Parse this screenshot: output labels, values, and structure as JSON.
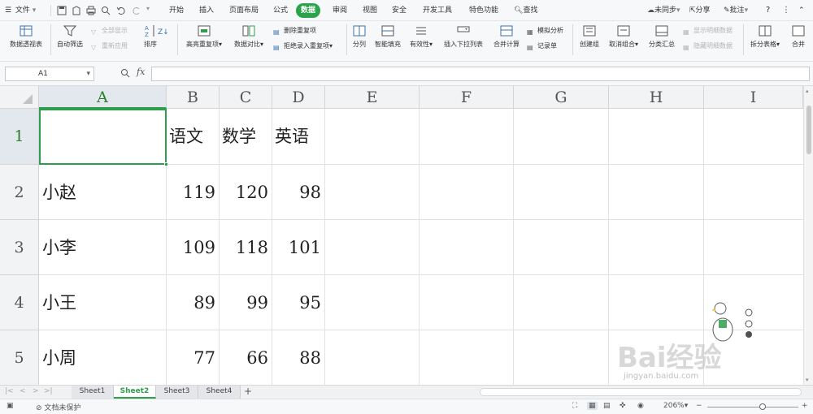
{
  "menu": {
    "file": "文件",
    "tabs": [
      "开始",
      "插入",
      "页面布局",
      "公式",
      "数据",
      "审阅",
      "视图",
      "安全",
      "开发工具",
      "特色功能"
    ],
    "active_tab": "数据",
    "search": "查找",
    "sync": "未同步",
    "share": "分享",
    "comment": "批注"
  },
  "ribbon": {
    "pivot": "数据透视表",
    "autofilter": "自动筛选",
    "show_all": "全部显示",
    "reapply": "重新应用",
    "sort": "排序",
    "highlight_dup": "高亮重复项",
    "compare": "数据对比",
    "delete_dup": "删除重复项",
    "reject_dup": "拒绝录入重复项",
    "split": "分列",
    "smart_fill": "智能填充",
    "validity": "有效性",
    "insert_dropdown": "插入下拉列表",
    "consolidate": "合并计算",
    "whatif": "模拟分析",
    "record": "记录单",
    "group": "创建组",
    "ungroup": "取消组合",
    "subtotal": "分类汇总",
    "show_detail": "显示明细数据",
    "hide_detail": "隐藏明细数据",
    "split_table": "拆分表格",
    "merge": "合并"
  },
  "formula_bar": {
    "cell_ref": "A1",
    "fx": "fx",
    "content": ""
  },
  "columns": [
    "A",
    "B",
    "C",
    "D",
    "E",
    "F",
    "G",
    "H",
    "I"
  ],
  "rows": [
    "1",
    "2",
    "3",
    "4",
    "5"
  ],
  "cells": [
    [
      "",
      "语文",
      "数学",
      "英语"
    ],
    [
      "小赵",
      "119",
      "120",
      "98"
    ],
    [
      "小李",
      "109",
      "118",
      "101"
    ],
    [
      "小王",
      "89",
      "99",
      "95"
    ],
    [
      "小周",
      "77",
      "66",
      "88"
    ]
  ],
  "sheets": [
    "Sheet1",
    "Sheet2",
    "Sheet3",
    "Sheet4"
  ],
  "active_sheet": "Sheet2",
  "add_sheet": "+",
  "status": {
    "protect": "文档未保护",
    "zoom": "206%"
  },
  "watermark": {
    "brand": "Bai经验",
    "url": "jingyan.baidu.com"
  },
  "colors": {
    "accent": "#2e9e4c",
    "active_tab_bg": "#2aa34a"
  }
}
